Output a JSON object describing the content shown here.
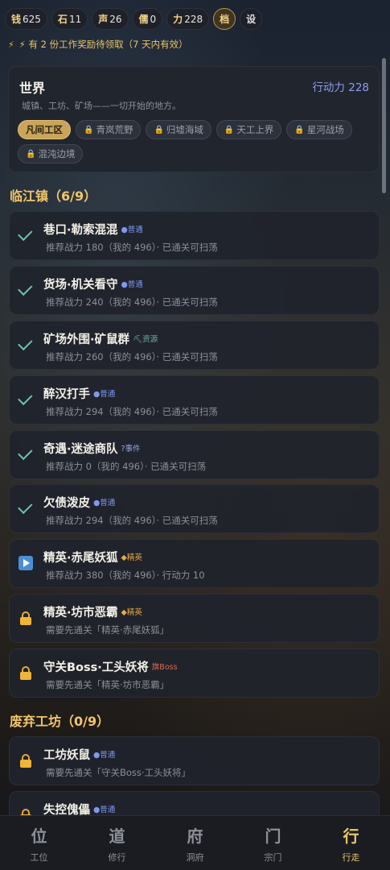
{
  "resources": [
    {
      "key": "钱",
      "value": "625"
    },
    {
      "key": "石",
      "value": "11"
    },
    {
      "key": "声",
      "value": "26"
    },
    {
      "key": "儒",
      "value": "0"
    },
    {
      "key": "力",
      "value": "228"
    }
  ],
  "archive_label": "档",
  "settings_label": "设",
  "notice": "⚡ 有 2 份工作奖励待领取（7 天内有效）",
  "world": {
    "title": "世界",
    "action_points": "行动力 228",
    "description": "城镇、工坊、矿场——一切开始的地方。",
    "tags": [
      {
        "label": "凡间工区",
        "active": true
      },
      {
        "label": "青岚荒野",
        "active": false
      },
      {
        "label": "归墟海域",
        "active": false
      },
      {
        "label": "天工上界",
        "active": false
      },
      {
        "label": "星河战场",
        "active": false
      },
      {
        "label": "混沌边境",
        "active": false
      }
    ]
  },
  "sections": [
    {
      "title": "临江镇（6/9）",
      "stages": [
        {
          "name": "巷口·勒索混混",
          "badge": "●普通",
          "badge_type": "normal",
          "status": "cleared",
          "sub": "推荐战力 180（我的 496）· 已通关可扫荡"
        },
        {
          "name": "货场·机关看守",
          "badge": "●普通",
          "badge_type": "normal",
          "status": "cleared",
          "sub": "推荐战力 240（我的 496）· 已通关可扫荡"
        },
        {
          "name": "矿场外围·矿鼠群",
          "badge": "⛏资源",
          "badge_type": "rare",
          "status": "cleared",
          "sub": "推荐战力 260（我的 496）· 已通关可扫荡"
        },
        {
          "name": "醉汉打手",
          "badge": "●普通",
          "badge_type": "normal",
          "status": "cleared",
          "sub": "推荐战力 294（我的 496）· 已通关可扫荡"
        },
        {
          "name": "奇遇·迷途商队",
          "badge": "?事件",
          "badge_type": "event",
          "status": "cleared",
          "sub": "推荐战力 0（我的 496）· 已通关可扫荡"
        },
        {
          "name": "欠债泼皮",
          "badge": "●普通",
          "badge_type": "normal",
          "status": "cleared",
          "sub": "推荐战力 294（我的 496）· 已通关可扫荡"
        },
        {
          "name": "精英·赤尾妖狐",
          "badge": "◆精英",
          "badge_type": "elite",
          "status": "current",
          "sub": "推荐战力 380（我的 496）· 行动力 10"
        },
        {
          "name": "精英·坊市恶霸",
          "badge": "◆精英",
          "badge_type": "elite",
          "status": "locked",
          "sub": "需要先通关「精英·赤尾妖狐」"
        },
        {
          "name": "守关Boss·工头妖将",
          "badge": "旗Boss",
          "badge_type": "boss",
          "status": "locked",
          "sub": "需要先通关「精英·坊市恶霸」"
        }
      ]
    },
    {
      "title": "废弃工坊（0/9）",
      "stages": [
        {
          "name": "工坊妖鼠",
          "badge": "●普通",
          "badge_type": "normal",
          "status": "locked",
          "sub": "需要先通关「守关Boss·工头妖将」"
        },
        {
          "name": "失控傀儡",
          "badge": "●普通",
          "badge_type": "normal",
          "status": "locked",
          "sub": ""
        }
      ]
    }
  ],
  "nav": [
    {
      "glyph": "位",
      "label": "工位",
      "active": false
    },
    {
      "glyph": "道",
      "label": "修行",
      "active": false
    },
    {
      "glyph": "府",
      "label": "洞府",
      "active": false
    },
    {
      "glyph": "门",
      "label": "宗门",
      "active": false
    },
    {
      "glyph": "行",
      "label": "行走",
      "active": true
    }
  ],
  "colors": {
    "accent_gold": "#e9c56b",
    "action_blue": "#8f9cf2",
    "cleared_green": "#6fc2ac",
    "lock_orange": "#f0b43a"
  }
}
